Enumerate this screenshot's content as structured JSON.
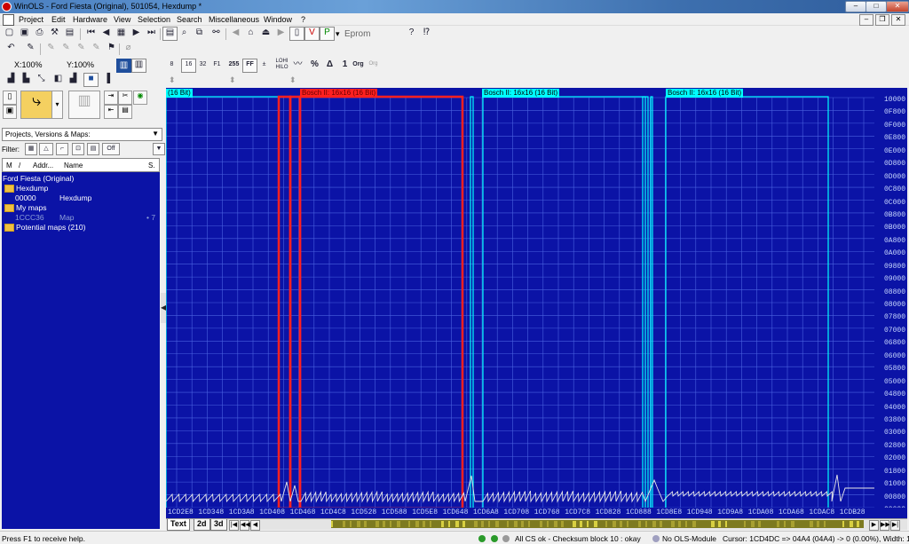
{
  "window": {
    "title": "WinOLS - Ford Fiesta (Original), 501054, Hexdump *",
    "minimize": "–",
    "maximize": "□",
    "close": "✕"
  },
  "menu": [
    "Project",
    "Edit",
    "Hardware",
    "View",
    "Selection",
    "Search",
    "Miscellaneous",
    "Window",
    "?"
  ],
  "mdi_controls": {
    "minimize": "–",
    "restore": "❐",
    "close": "✕"
  },
  "toolbar": {
    "eprom_label": "Eprom",
    "zoom_x": "X:100%",
    "zoom_y": "Y:100%",
    "btn_off": "Off",
    "fmt_8": "8",
    "fmt_16": "16",
    "fmt_32": "32",
    "fmt_f1": "F1",
    "fmt_255": "255",
    "fmt_ff": "FF",
    "fmt_hilo": "HILO",
    "fmt_lohi": "LOHI",
    "pct": "%",
    "delta": "Δ",
    "one": "1",
    "org": "Org",
    "orgorg": "Org"
  },
  "left_panel": {
    "dropdown_value": "Projects, Versions & Maps:",
    "filter_label": "Filter:",
    "filter_off": "Off",
    "columns": [
      "M",
      "/",
      "Addr...",
      "Name",
      "S."
    ],
    "tree": [
      {
        "label": "Ford Fiesta (Original)",
        "type": "project"
      },
      {
        "label": "Hexdump",
        "type": "folder"
      },
      {
        "addr": "00000",
        "name": "Hexdump",
        "type": "item"
      },
      {
        "label": "My maps",
        "type": "folder"
      },
      {
        "addr": "1CCC36",
        "name": "Map",
        "size": "• 7",
        "type": "item"
      },
      {
        "label": "Potential maps (210)",
        "type": "folder"
      }
    ]
  },
  "map_tags": [
    {
      "label": "(16 Bit)",
      "color": "#00ffff"
    },
    {
      "label": "Bosch II: 16x16 (16 Bit)",
      "color": "#ff2020"
    },
    {
      "label": "Bosch II: 16x16 (16 Bit)",
      "color": "#00ffff"
    },
    {
      "label": "Bosch II: 16x16 (16 Bit)",
      "color": "#00ffff"
    }
  ],
  "y_ticks": [
    "10000",
    "0F800",
    "0F000",
    "0E800",
    "0E000",
    "0D800",
    "0D000",
    "0C800",
    "0C000",
    "0B800",
    "0B000",
    "0A800",
    "0A000",
    "09800",
    "09000",
    "08800",
    "08000",
    "07800",
    "07000",
    "06800",
    "06000",
    "05800",
    "05000",
    "04800",
    "04000",
    "03800",
    "03000",
    "02800",
    "02000",
    "01800",
    "01000",
    "00800",
    "00000"
  ],
  "x_ticks": [
    "1CD2E8",
    "1CD348",
    "1CD3A8",
    "1CD408",
    "1CD468",
    "1CD4C8",
    "1CD528",
    "1CD588",
    "1CD5E8",
    "1CD648",
    "1CD6A8",
    "1CD708",
    "1CD768",
    "1CD7C8",
    "1CD828",
    "1CD888",
    "1CD8E8",
    "1CD948",
    "1CD9A8",
    "1CDA08",
    "1CDA68",
    "1CDAC8",
    "1CDB28"
  ],
  "view_tabs": [
    "Text",
    "2d",
    "3d"
  ],
  "status": {
    "help": "Press F1 to receive help.",
    "checksum": "All CS ok - Checksum block 10 : okay",
    "module": "No OLS-Module",
    "cursor": "Cursor: 1CD4DC => 04A4 (04A4) -> 0 (0.00%), Width: 16"
  },
  "colors": {
    "background": "#0b13a6",
    "grid": "#4a62e0",
    "map_selected": "#ff2020",
    "map_other": "#00ffff",
    "curve": "#e8e8e8"
  }
}
